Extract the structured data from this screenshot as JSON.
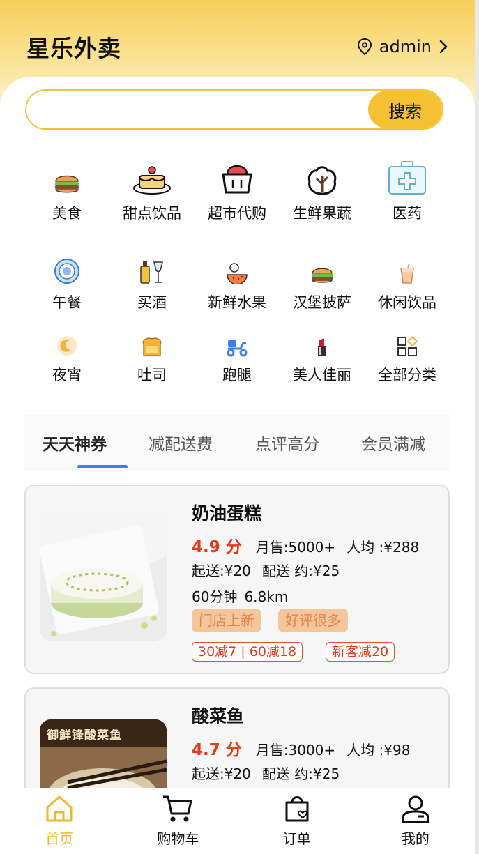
{
  "header": {
    "title": "星乐外卖",
    "user": "admin"
  },
  "search": {
    "placeholder": "",
    "button_label": "搜索"
  },
  "categories_row1": [
    {
      "label": "美食",
      "icon": "burger-icon"
    },
    {
      "label": "甜点饮品",
      "icon": "cake-icon"
    },
    {
      "label": "超市代购",
      "icon": "basket-icon"
    },
    {
      "label": "生鲜果蔬",
      "icon": "cabbage-icon"
    },
    {
      "label": "医药",
      "icon": "medical-kit-icon"
    }
  ],
  "categories_row2": [
    {
      "label": "午餐",
      "icon": "plate-icon"
    },
    {
      "label": "买酒",
      "icon": "wine-icon"
    },
    {
      "label": "新鲜水果",
      "icon": "fruit-icon"
    },
    {
      "label": "汉堡披萨",
      "icon": "hamburger-icon"
    },
    {
      "label": "休闲饮品",
      "icon": "drink-icon"
    }
  ],
  "categories_row3": [
    {
      "label": "夜宵",
      "icon": "moon-icon"
    },
    {
      "label": "吐司",
      "icon": "toast-icon"
    },
    {
      "label": "跑腿",
      "icon": "scooter-icon"
    },
    {
      "label": "美人佳丽",
      "icon": "lipstick-icon"
    },
    {
      "label": "全部分类",
      "icon": "grid-icon"
    }
  ],
  "tabs": [
    "天天神券",
    "减配送费",
    "点评高分",
    "会员满减"
  ],
  "active_tab": "天天神券",
  "stores": [
    {
      "name": "奶油蛋糕",
      "score": "4.9 分",
      "monthly_sales": "月售:5000+",
      "avg_price": "人均 :¥288",
      "min_order": "起送:¥20",
      "delivery_fee": "配送 约:¥25",
      "time": "60分钟",
      "distance": "6.8km",
      "tags": [
        "门店上新",
        "好评很多"
      ],
      "coupons": [
        "30减7 | 60减18",
        "新客减20"
      ]
    },
    {
      "name": "酸菜鱼",
      "score": "4.7 分",
      "monthly_sales": "月售:3000+",
      "avg_price": "人均 :¥98",
      "min_order": "起送:¥20",
      "delivery_fee": "配送 约:¥25",
      "image_caption": "御鲜锋酸菜鱼"
    }
  ],
  "bottom_nav": [
    {
      "label": "首页",
      "icon": "home-icon"
    },
    {
      "label": "购物车",
      "icon": "cart-icon"
    },
    {
      "label": "订单",
      "icon": "order-bag-icon"
    },
    {
      "label": "我的",
      "icon": "user-icon"
    }
  ],
  "active_nav": "首页",
  "colors": {
    "accent": "#f5c132",
    "price_red": "#e23a1a",
    "tab_indicator": "#3a80ef"
  }
}
